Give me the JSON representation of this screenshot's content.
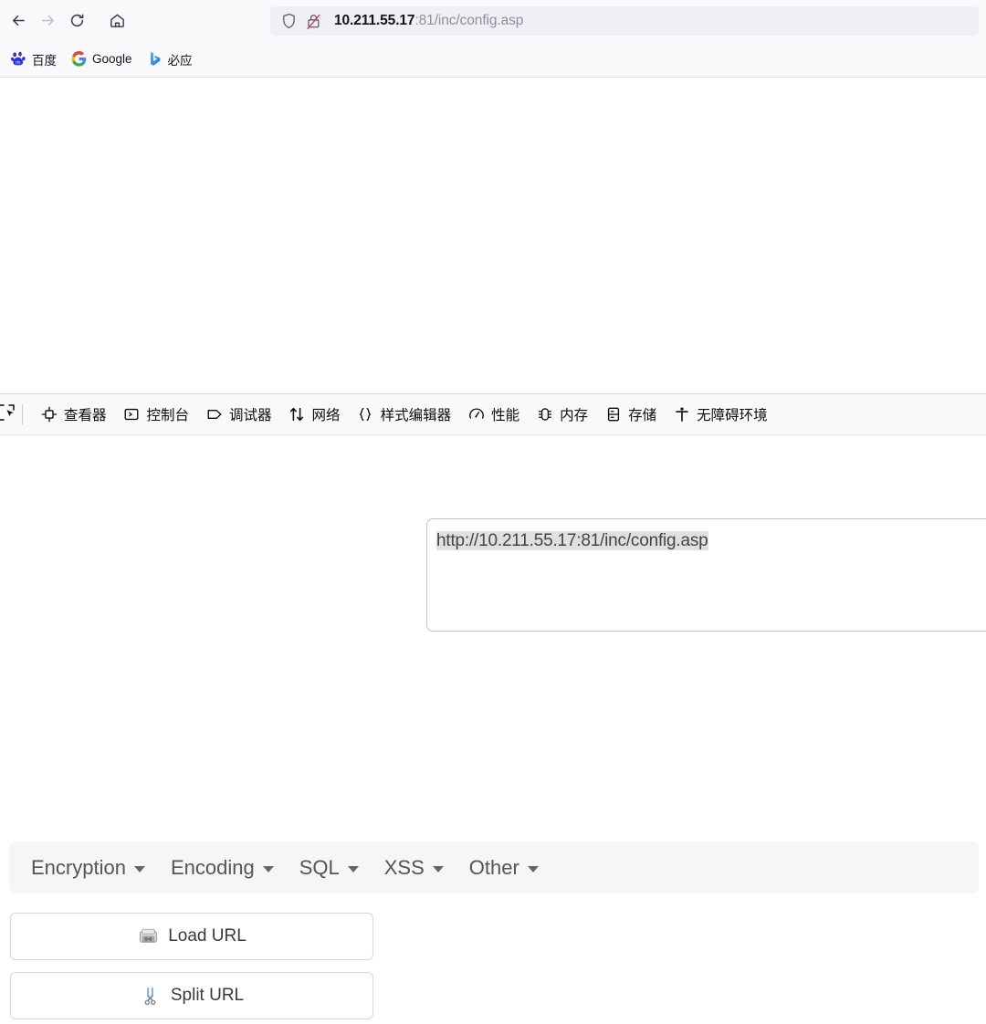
{
  "browser": {
    "nav": {
      "back_label": "Back",
      "back_icon": "arrow-left-icon",
      "forward_label": "Forward",
      "forward_icon": "arrow-right-icon",
      "reload_label": "Reload",
      "reload_icon": "reload-icon",
      "home_label": "Home",
      "home_icon": "home-icon"
    },
    "urlbar": {
      "shield_icon": "shield-icon",
      "insecure_icon": "lock-crossed-out-icon",
      "host": "10.211.55.17",
      "path": ":81/inc/config.asp",
      "full_url": "10.211.55.17:81/inc/config.asp"
    },
    "bookmarks": [
      {
        "label": "百度",
        "icon": "baidu-paw-icon"
      },
      {
        "label": "Google",
        "icon": "google-g-icon"
      },
      {
        "label": "必应",
        "icon": "bing-b-icon"
      }
    ]
  },
  "devtools": {
    "picker_icon": "element-picker-icon",
    "tabs": [
      {
        "label": "查看器",
        "icon": "inspector-icon"
      },
      {
        "label": "控制台",
        "icon": "console-icon"
      },
      {
        "label": "调试器",
        "icon": "debugger-icon"
      },
      {
        "label": "网络",
        "icon": "network-icon"
      },
      {
        "label": "样式编辑器",
        "icon": "style-editor-icon"
      },
      {
        "label": "性能",
        "icon": "performance-icon"
      },
      {
        "label": "内存",
        "icon": "memory-icon"
      },
      {
        "label": "存储",
        "icon": "storage-icon"
      },
      {
        "label": "无障碍环境",
        "icon": "accessibility-icon"
      }
    ]
  },
  "hackbar": {
    "menu": [
      {
        "label": "Encryption"
      },
      {
        "label": "Encoding"
      },
      {
        "label": "SQL"
      },
      {
        "label": "XSS"
      },
      {
        "label": "Other"
      }
    ],
    "buttons": [
      {
        "label": "Load URL",
        "icon": "drive-disk-icon"
      },
      {
        "label": "Split URL",
        "icon": "scissors-icon"
      }
    ],
    "url_field": {
      "value": "http://10.211.55.17:81/inc/config.asp",
      "placeholder": "",
      "selected": true
    }
  },
  "colors": {
    "chrome_bg": "#f9f9fb",
    "urlbar_bg": "#f0f0f4",
    "url_host_text": "#15141a",
    "url_path_text": "#8f8f9d",
    "devtools_toolbar_bg": "#f9f9fa",
    "hackbar_menu_bg": "#f6f6f6",
    "hackbar_menu_text": "#555555",
    "selection_highlight": "#e0e0e0",
    "insecure_red": "#e02b4a"
  }
}
